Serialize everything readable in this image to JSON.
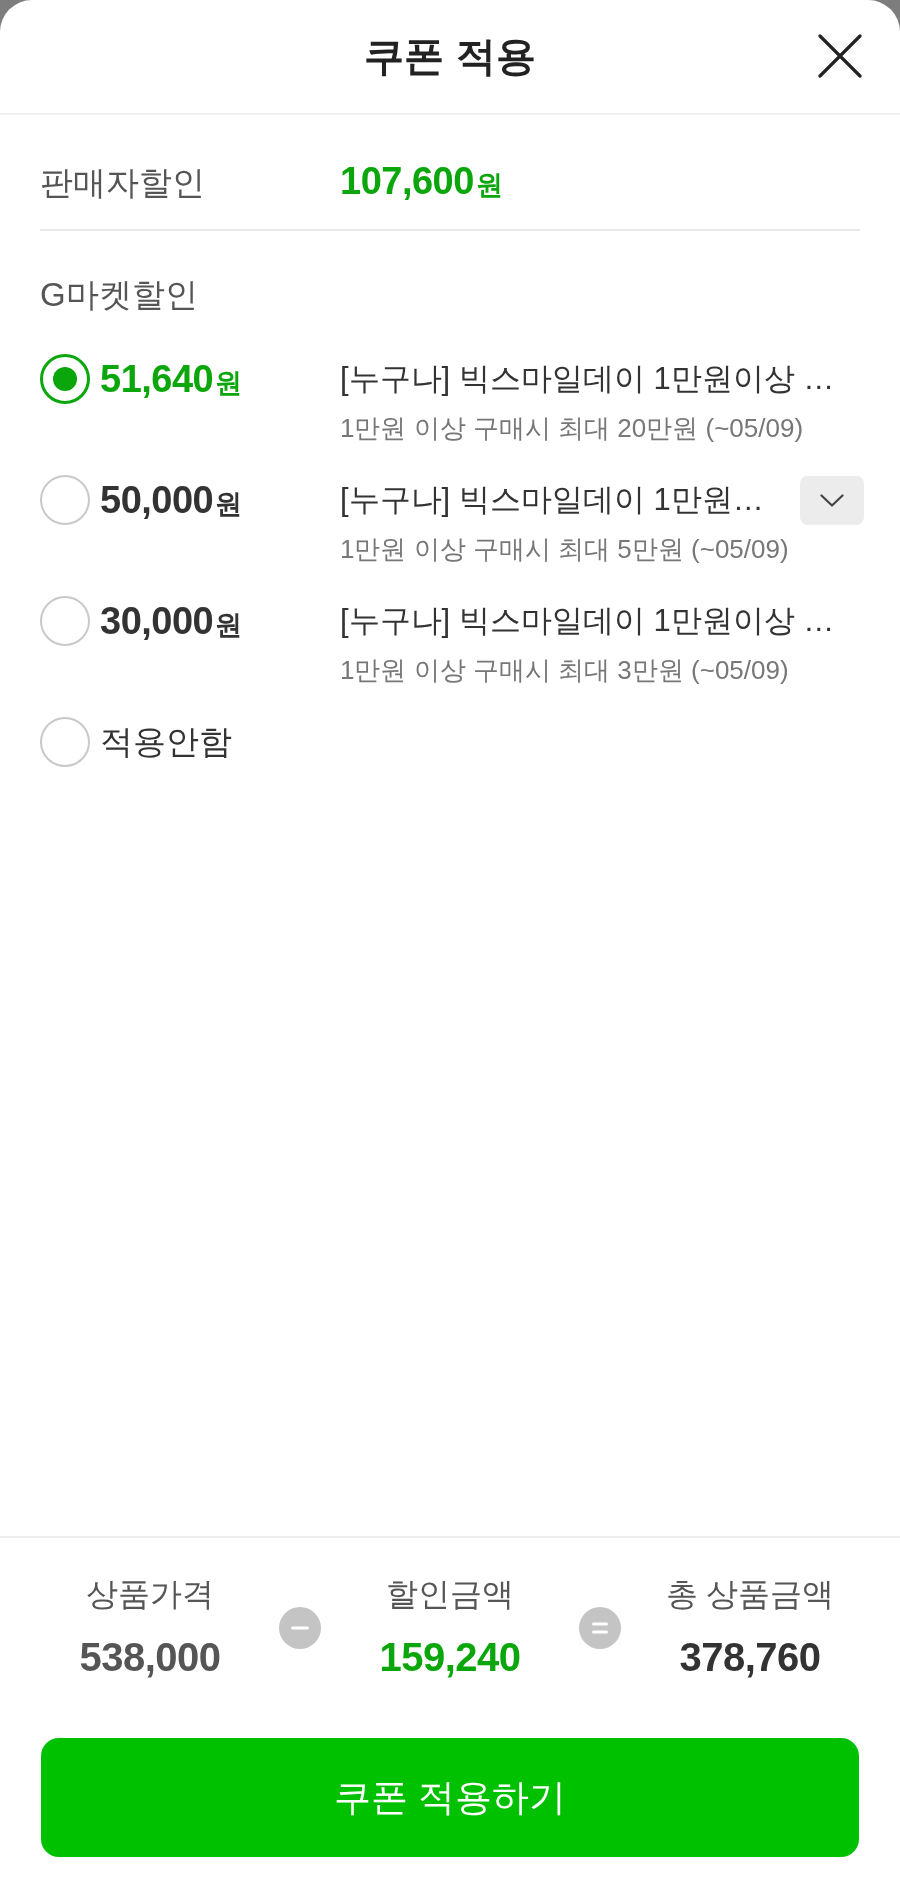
{
  "header": {
    "title": "쿠폰 적용"
  },
  "seller_discount": {
    "label": "판매자할인",
    "amount": "107,600",
    "unit": "원"
  },
  "gmarket_discount": {
    "label": "G마켓할인",
    "options": [
      {
        "kind": "coupon",
        "selected": true,
        "amount": "51,640",
        "unit": "원",
        "title": "[누구나] 빅스마일데이 1만원이상 …",
        "description": "1만원 이상 구매시 최대 20만원 (~05/09)",
        "expandable": false
      },
      {
        "kind": "coupon",
        "selected": false,
        "amount": "50,000",
        "unit": "원",
        "title": "[누구나] 빅스마일데이 1만원…",
        "description": "1만원 이상 구매시 최대 5만원 (~05/09)",
        "expandable": true
      },
      {
        "kind": "coupon",
        "selected": false,
        "amount": "30,000",
        "unit": "원",
        "title": "[누구나] 빅스마일데이 1만원이상 …",
        "description": "1만원 이상 구매시 최대 3만원 (~05/09)",
        "expandable": false
      },
      {
        "kind": "none",
        "selected": false,
        "label": "적용안함"
      }
    ]
  },
  "summary": {
    "items": [
      {
        "kind": "price",
        "label": "상품가격",
        "value": "538,000"
      },
      {
        "kind": "discount",
        "label": "할인금액",
        "value": "159,240"
      },
      {
        "kind": "total",
        "label": "총 상품금액",
        "value": "378,760"
      }
    ]
  },
  "apply_button": {
    "label": "쿠폰 적용하기"
  }
}
